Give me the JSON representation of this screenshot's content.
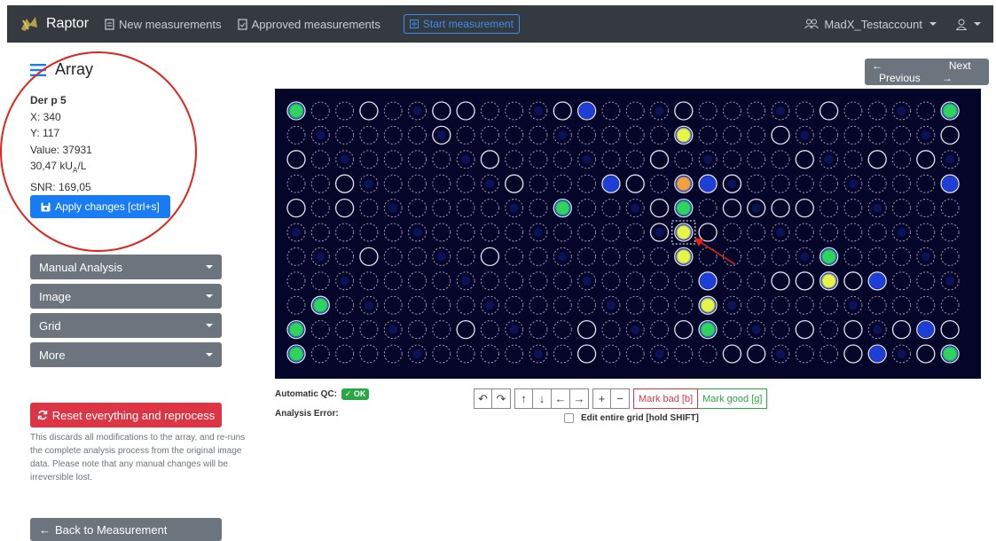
{
  "navbar": {
    "brand": "Raptor",
    "links": [
      "New measurements",
      "Approved measurements"
    ],
    "start_button": "Start measurement",
    "account": "MadX_Testaccount"
  },
  "page": {
    "title": "Array"
  },
  "spot_info": {
    "name": "Der p 5",
    "x": "X: 340",
    "y": "Y: 117",
    "value": "Value: 37931",
    "conc_prefix": "30,47 kU",
    "conc_sub": "A",
    "conc_suffix": "/L",
    "snr": "SNR: 169,05"
  },
  "apply_button": "Apply changes [ctrl+s]",
  "dropdowns": [
    "Manual Analysis",
    "Image",
    "Grid",
    "More"
  ],
  "reset": {
    "button": "Reset everything and reprocess",
    "note": "This discards all modifications to the array, and re-runs the complete analysis process from the original image data. Please note that any manual changes will be irreversible lost."
  },
  "back_button": "Back to Measurement",
  "pager": {
    "previous": "Previous",
    "next": "Next"
  },
  "qc": {
    "auto_label": "Automatic QC:",
    "auto_status": "OK",
    "error_label": "Analysis Error:"
  },
  "toolbar": {
    "buttons": [
      "↶",
      "↷",
      "↑",
      "↓",
      "←",
      "→",
      "+",
      "−"
    ],
    "mark_bad": "Mark bad [b]",
    "mark_good": "Mark good [g]",
    "edit_grid": "Edit entire grid [hold SHIFT]"
  },
  "array": {
    "rows": 11,
    "cols": 28,
    "selected": {
      "row": 5,
      "col": 16
    },
    "spots": [
      {
        "r": 0,
        "c": 0,
        "t": "green"
      },
      {
        "r": 0,
        "c": 12,
        "t": "blue"
      },
      {
        "r": 0,
        "c": 27,
        "t": "green"
      },
      {
        "r": 1,
        "c": 16,
        "t": "yellow"
      },
      {
        "r": 3,
        "c": 13,
        "t": "blue"
      },
      {
        "r": 3,
        "c": 16,
        "t": "orange"
      },
      {
        "r": 3,
        "c": 17,
        "t": "blue"
      },
      {
        "r": 3,
        "c": 27,
        "t": "blue"
      },
      {
        "r": 4,
        "c": 11,
        "t": "green"
      },
      {
        "r": 4,
        "c": 16,
        "t": "green"
      },
      {
        "r": 5,
        "c": 16,
        "t": "yellow"
      },
      {
        "r": 6,
        "c": 16,
        "t": "yellow"
      },
      {
        "r": 6,
        "c": 22,
        "t": "green"
      },
      {
        "r": 7,
        "c": 17,
        "t": "blue"
      },
      {
        "r": 7,
        "c": 22,
        "t": "yellow"
      },
      {
        "r": 7,
        "c": 24,
        "t": "blue"
      },
      {
        "r": 8,
        "c": 1,
        "t": "green"
      },
      {
        "r": 8,
        "c": 17,
        "t": "yellow"
      },
      {
        "r": 9,
        "c": 0,
        "t": "green"
      },
      {
        "r": 9,
        "c": 17,
        "t": "green"
      },
      {
        "r": 9,
        "c": 26,
        "t": "blue"
      },
      {
        "r": 10,
        "c": 0,
        "t": "green"
      },
      {
        "r": 10,
        "c": 24,
        "t": "blue"
      },
      {
        "r": 10,
        "c": 27,
        "t": "green"
      }
    ],
    "solid_rings": [
      [
        0,
        3
      ],
      [
        0,
        6
      ],
      [
        0,
        7
      ],
      [
        0,
        11
      ],
      [
        0,
        16
      ],
      [
        0,
        22
      ],
      [
        0,
        27
      ],
      [
        1,
        6
      ],
      [
        1,
        16
      ],
      [
        1,
        20
      ],
      [
        1,
        27
      ],
      [
        2,
        0
      ],
      [
        2,
        8
      ],
      [
        2,
        15
      ],
      [
        2,
        21
      ],
      [
        2,
        24
      ],
      [
        2,
        26
      ],
      [
        3,
        2
      ],
      [
        3,
        9
      ],
      [
        3,
        14
      ],
      [
        3,
        18
      ],
      [
        3,
        27
      ],
      [
        4,
        0
      ],
      [
        4,
        2
      ],
      [
        4,
        15
      ],
      [
        4,
        18
      ],
      [
        4,
        19
      ],
      [
        4,
        20
      ],
      [
        4,
        21
      ],
      [
        5,
        15
      ],
      [
        5,
        17
      ],
      [
        6,
        3
      ],
      [
        6,
        8
      ],
      [
        6,
        22
      ],
      [
        7,
        20
      ],
      [
        7,
        21
      ],
      [
        7,
        23
      ],
      [
        8,
        1
      ],
      [
        8,
        17
      ],
      [
        9,
        7
      ],
      [
        9,
        12
      ],
      [
        9,
        16
      ],
      [
        9,
        21
      ],
      [
        9,
        23
      ],
      [
        9,
        25
      ],
      [
        9,
        26
      ],
      [
        9,
        27
      ],
      [
        10,
        12
      ],
      [
        10,
        18
      ],
      [
        10,
        19
      ],
      [
        10,
        23
      ],
      [
        10,
        26
      ]
    ],
    "colors": {
      "green": "#2fd45a",
      "yellow": "#e8f545",
      "orange": "#f2a23a",
      "blue": "#1d3fd8"
    }
  }
}
